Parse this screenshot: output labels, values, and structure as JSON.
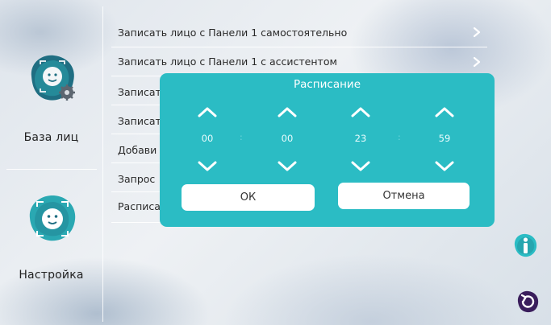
{
  "sidebar": {
    "items": [
      {
        "label": "База лиц",
        "icon": "face-settings-icon"
      },
      {
        "label": "Настройка",
        "icon": "face-scan-icon"
      }
    ]
  },
  "list": {
    "rows": [
      {
        "label": "Записать лицо с Панели 1 самостоятельно",
        "has_chevron": true
      },
      {
        "label": "Записать лицо с Панели 1 с ассистентом",
        "has_chevron": true
      },
      {
        "label": "Записат",
        "has_chevron": false
      },
      {
        "label": "Записат",
        "has_chevron": false
      },
      {
        "label": "Добави",
        "has_chevron": false
      },
      {
        "label": "Запрос",
        "has_chevron": false
      },
      {
        "label": "Расписа",
        "has_chevron": false
      }
    ]
  },
  "dialog": {
    "title": "Расписание",
    "start_hour": "00",
    "start_minute": "00",
    "end_hour": "23",
    "end_minute": "59",
    "separator": ":",
    "ok_label": "ОК",
    "cancel_label": "Отмена"
  },
  "buttons": {
    "info_icon": "info-icon",
    "back_icon": "back-arrow-icon"
  },
  "colors": {
    "accent": "#2bbcc4",
    "accent_dark": "#1f6e82",
    "purple": "#3a1e5c"
  }
}
